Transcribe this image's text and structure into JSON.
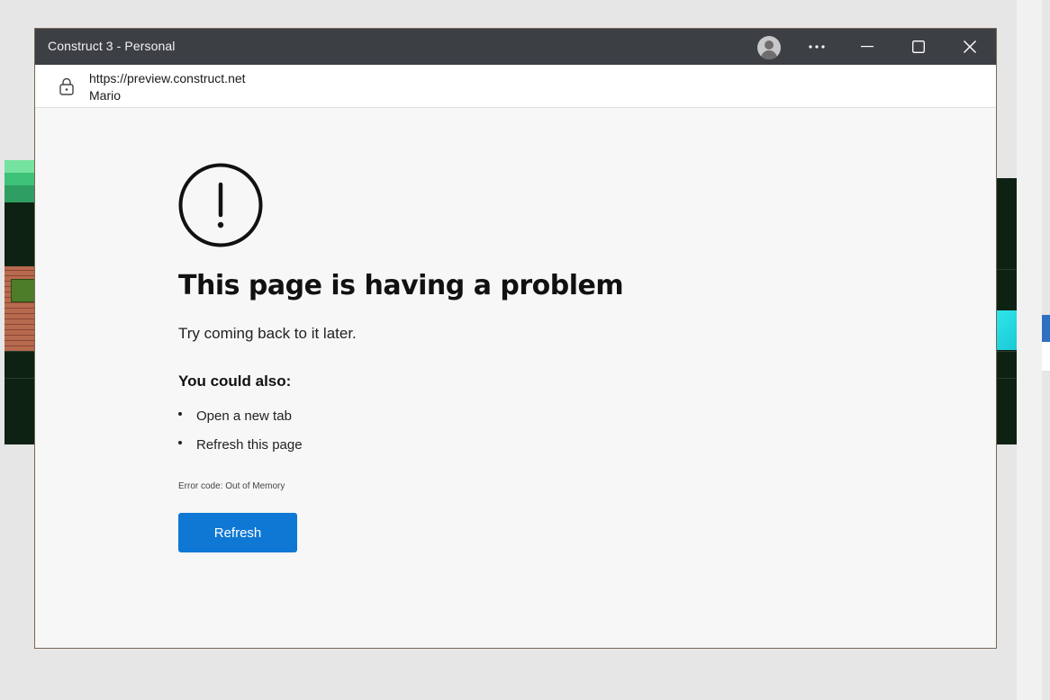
{
  "window": {
    "title": "Construct 3 - Personal",
    "controls": {
      "profile_icon": "person-avatar-icon",
      "more_icon": "ellipsis-icon",
      "minimize_icon": "minimize-icon",
      "maximize_icon": "maximize-icon",
      "close_icon": "close-icon"
    }
  },
  "address": {
    "url": "https://preview.construct.net",
    "page_title": "Mario",
    "lock_icon": "lock-icon"
  },
  "error_page": {
    "icon": "exclamation-circle-icon",
    "heading": "This page is having a problem",
    "message": "Try coming back to it later.",
    "suggestions_heading": "You could also:",
    "suggestions": [
      "Open a new tab",
      "Refresh this page"
    ],
    "error_code": "Error code: Out of Memory",
    "refresh_label": "Refresh",
    "accent_color": "#0f78d4"
  }
}
